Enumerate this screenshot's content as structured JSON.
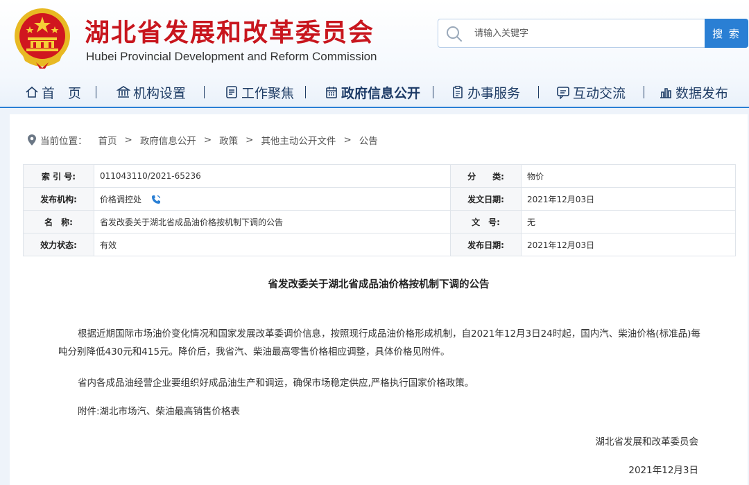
{
  "header": {
    "title_cn": "湖北省发展和改革委员会",
    "title_en": "Hubei Provincial Development and Reform Commission",
    "search_placeholder": "请输入关键字",
    "search_button": "搜 索",
    "emblem_icon": "national-emblem"
  },
  "nav": {
    "items": [
      {
        "label": "首　页",
        "icon": "home-icon"
      },
      {
        "label": "机构设置",
        "icon": "bank-icon"
      },
      {
        "label": "工作聚焦",
        "icon": "document-icon"
      },
      {
        "label": "政府信息公开",
        "icon": "calendar-icon",
        "active": true
      },
      {
        "label": "办事服务",
        "icon": "clipboard-icon"
      },
      {
        "label": "互动交流",
        "icon": "chat-icon"
      },
      {
        "label": "数据发布",
        "icon": "bar-chart-icon"
      }
    ]
  },
  "breadcrumb": {
    "label": "当前位置：",
    "items": [
      "首页",
      "政府信息公开",
      "政策",
      "其他主动公开文件",
      "公告"
    ],
    "separator": ">"
  },
  "meta": {
    "index_label": "索 引 号:",
    "index_value": "011043110/2021-65236",
    "category_label": "分　　类:",
    "category_value": "物价",
    "publisher_label": "发布机构:",
    "publisher_value": "价格调控处",
    "issue_date_label": "发文日期:",
    "issue_date_value": "2021年12月03日",
    "name_label": "名　称:",
    "name_value": "省发改委关于湖北省成品油价格按机制下调的公告",
    "doc_no_label": "文　号:",
    "doc_no_value": "无",
    "status_label": "效力状态:",
    "status_value": "有效",
    "publish_date_label": "发布日期:",
    "publish_date_value": "2021年12月03日"
  },
  "article": {
    "title": "省发改委关于湖北省成品油价格按机制下调的公告",
    "p1": "根据近期国际市场油价变化情况和国家发展改革委调价信息，按照现行成品油价格形成机制，自2021年12月3日24时起，国内汽、柴油价格(标准品)每吨分别降低430元和415元。降价后，我省汽、柴油最高零售价格相应调整，具体价格见附件。",
    "p2": "省内各成品油经营企业要组织好成品油生产和调运，确保市场稳定供应,严格执行国家价格政策。",
    "p3": "附件:湖北市场汽、柴油最高销售价格表",
    "signer": "湖北省发展和改革委员会",
    "sign_date": "2021年12月3日"
  },
  "colors": {
    "brand_red": "#c8161e",
    "accent_blue": "#2a7fd4",
    "nav_text": "#1f3d66"
  }
}
